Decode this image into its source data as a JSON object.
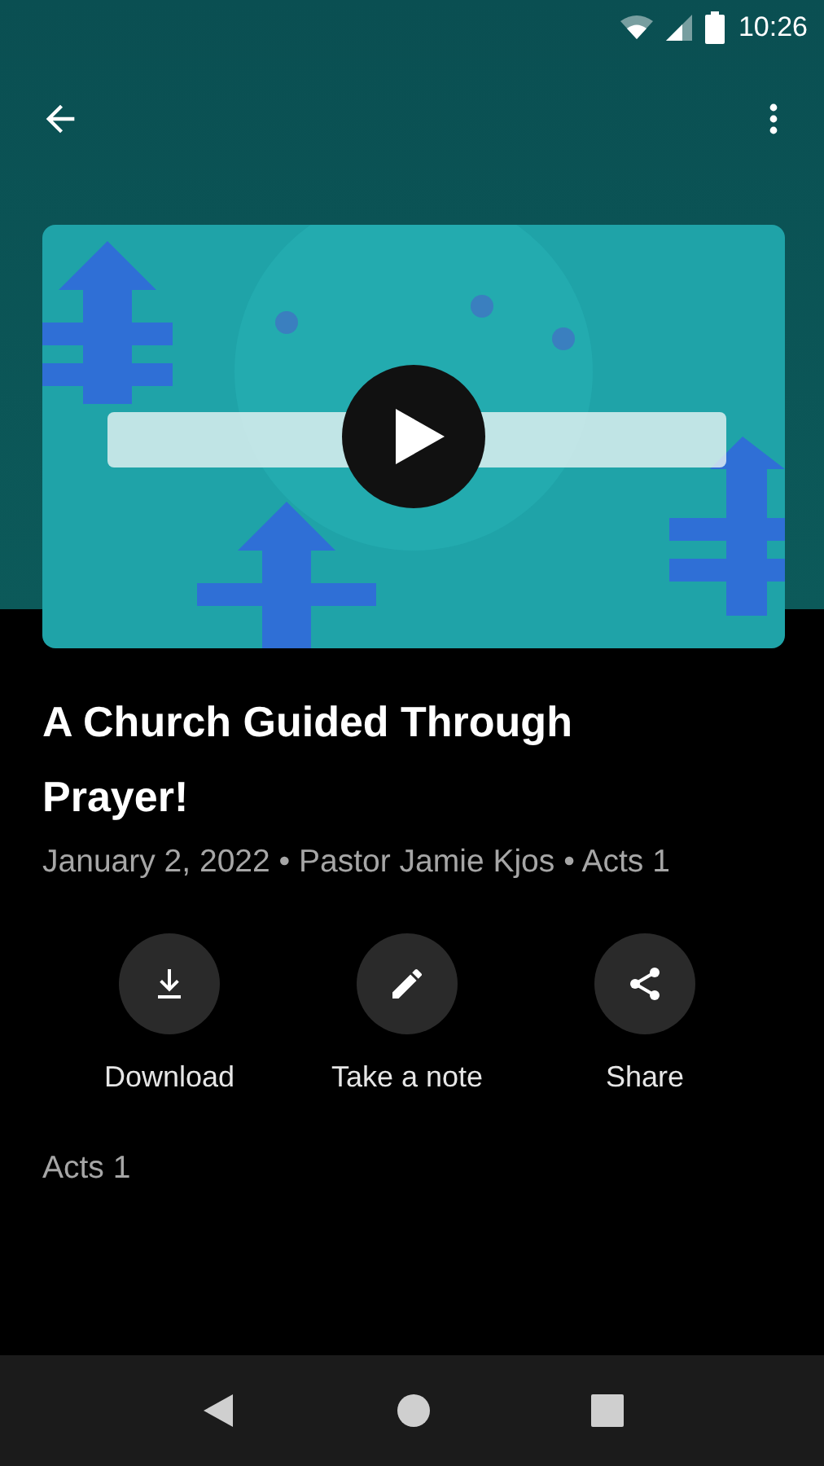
{
  "status_bar": {
    "time": "10:26"
  },
  "title": "A Church Guided Through Prayer!",
  "meta": "January 2, 2022 • Pastor Jamie Kjos • Acts 1",
  "actions": [
    {
      "kind": "download",
      "label": "Download"
    },
    {
      "kind": "note",
      "label": "Take a note"
    },
    {
      "kind": "share",
      "label": "Share"
    }
  ],
  "scripture": "Acts 1"
}
